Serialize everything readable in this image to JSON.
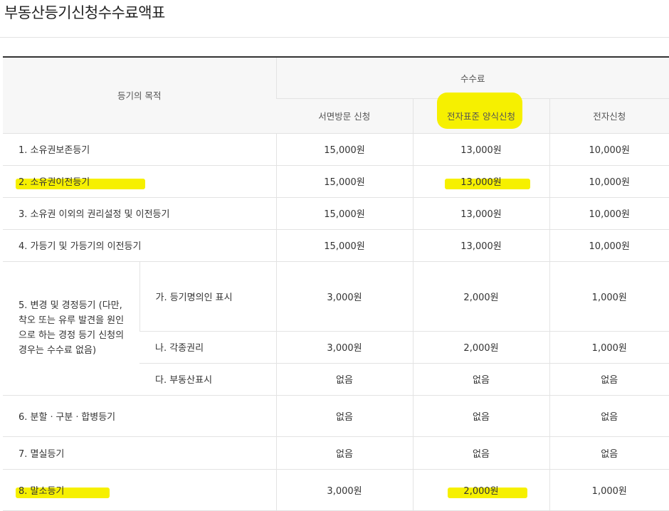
{
  "page": {
    "title": "부동산등기신청수수료액표"
  },
  "table": {
    "header": {
      "purpose": "등기의 목적",
      "fee_group": "수수료",
      "columns": [
        "서면방문 신청",
        "전자표준 양식신청",
        "전자신청"
      ]
    },
    "rows": [
      {
        "label": "1. 소유권보존등기",
        "fees": [
          "15,000원",
          "13,000원",
          "10,000원"
        ]
      },
      {
        "label": "2. 소유권이전등기",
        "fees": [
          "15,000원",
          "13,000원",
          "10,000원"
        ]
      },
      {
        "label": "3. 소유권 이외의 권리설정 및 이전등기",
        "fees": [
          "15,000원",
          "13,000원",
          "10,000원"
        ]
      },
      {
        "label": "4. 가등기 및 가등기의 이전등기",
        "fees": [
          "15,000원",
          "13,000원",
          "10,000원"
        ]
      },
      {
        "label": "5. 변경 및 경정등기 (다만, 착오 또는 유루 발견을 원인으로 하는 경정 등기 신청의 경우는 수수료 없음)",
        "subrows": [
          {
            "label": "가. 등기명의인 표시",
            "fees": [
              "3,000원",
              "2,000원",
              "1,000원"
            ]
          },
          {
            "label": "나. 각종권리",
            "fees": [
              "3,000원",
              "2,000원",
              "1,000원"
            ]
          },
          {
            "label": "다. 부동산표시",
            "fees": [
              "없음",
              "없음",
              "없음"
            ]
          }
        ]
      },
      {
        "label": "6. 분할ㆍ구분ㆍ합병등기",
        "fees": [
          "없음",
          "없음",
          "없음"
        ]
      },
      {
        "label": "7. 멸실등기",
        "fees": [
          "없음",
          "없음",
          "없음"
        ]
      },
      {
        "label": "8. 말소등기",
        "fees": [
          "3,000원",
          "2,000원",
          "1,000원"
        ]
      }
    ]
  },
  "highlight_color": "#f6f000"
}
